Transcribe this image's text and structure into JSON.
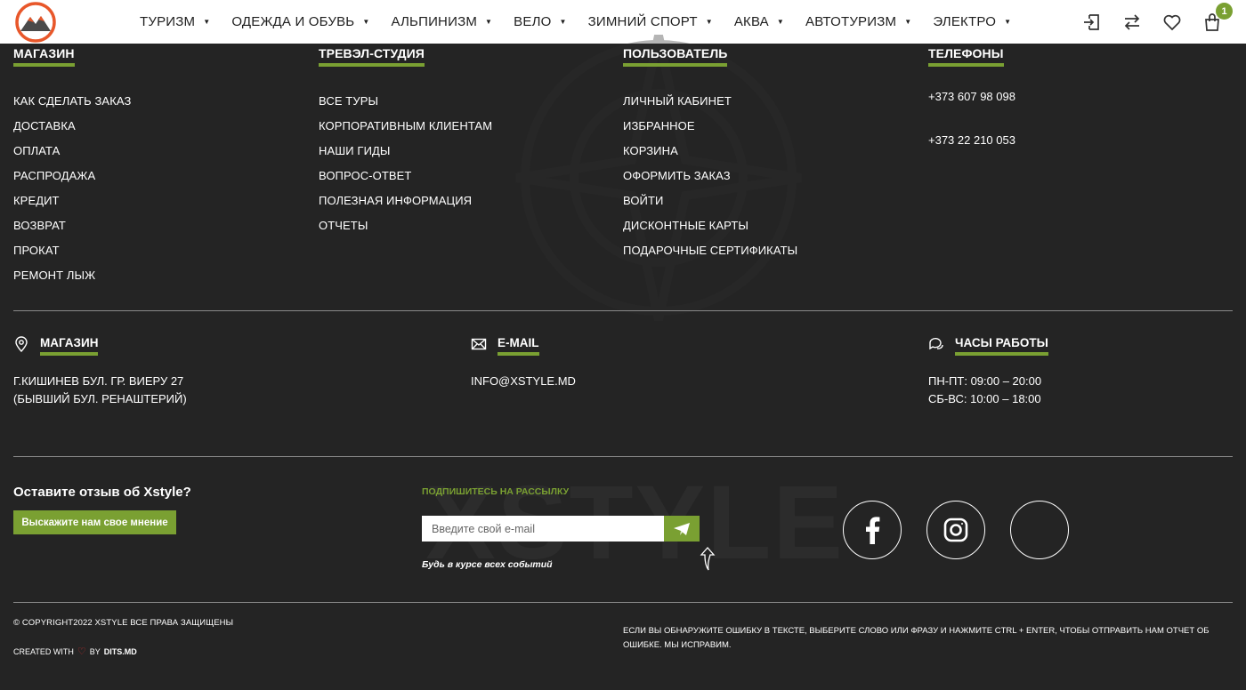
{
  "header": {
    "nav": [
      {
        "label": "ТУРИЗМ"
      },
      {
        "label": "ОДЕЖДА И ОБУВЬ"
      },
      {
        "label": "АЛЬПИНИЗМ"
      },
      {
        "label": "ВЕЛО"
      },
      {
        "label": "ЗИМНИЙ СПОРТ"
      },
      {
        "label": "АКВА"
      },
      {
        "label": "АВТОТУРИЗМ"
      },
      {
        "label": "ЭЛЕКТРО"
      }
    ],
    "cart_count": "1",
    "icons": [
      "login-icon",
      "compare-icon",
      "wishlist-icon",
      "cart-icon"
    ]
  },
  "columns": {
    "shop": {
      "title": "МАГАЗИН",
      "links": [
        "КАК СДЕЛАТЬ ЗАКАЗ",
        "ДОСТАВКА",
        "ОПЛАТА",
        "РАСПРОДАЖА",
        "КРЕДИТ",
        "ВОЗВРАТ",
        "ПРОКАТ",
        "РЕМОНТ ЛЫЖ"
      ]
    },
    "travel": {
      "title": "ТРЕВЭЛ-СТУДИЯ",
      "links": [
        "ВСЕ ТУРЫ",
        "КОРПОРАТИВНЫМ КЛИЕНТАМ",
        "НАШИ ГИДЫ",
        "ВОПРОС-ОТВЕТ",
        "ПОЛЕЗНАЯ ИНФОРМАЦИЯ",
        "ОТЧЕТЫ"
      ]
    },
    "user": {
      "title": "ПОЛЬЗОВАТЕЛЬ",
      "links": [
        "ЛИЧНЫЙ КАБИНЕТ",
        "ИЗБРАННОЕ",
        "КОРЗИНА",
        "ОФОРМИТЬ ЗАКАЗ",
        "ВОЙТИ",
        "ДИСКОНТНЫЕ КАРТЫ",
        "ПОДАРОЧНЫЕ СЕРТИФИКАТЫ"
      ]
    },
    "phones": {
      "title": "ТЕЛЕФОНЫ",
      "items": [
        "+373 607 98 098",
        "+373 22 210 053"
      ]
    }
  },
  "info": {
    "store": {
      "title": "МАГАЗИН",
      "line1": "Г.КИШИНЕВ БУЛ. ГР. ВИЕРУ 27",
      "line2": "(БЫВШИЙ БУЛ. РЕНАШТЕРИЙ)",
      "icon": "location-pin-icon"
    },
    "email": {
      "title": "E-MAIL",
      "value": "INFO@XSTYLE.MD",
      "icon": "envelope-icon"
    },
    "hours": {
      "title": "ЧАСЫ РАБОТЫ",
      "line1": "ПН-ПТ: 09:00 – 20:00",
      "line2": "СБ-ВС: 10:00 – 18:00",
      "icon": "chat-bubbles-icon"
    }
  },
  "review": {
    "title": "Оставите отзыв об Xstyle?",
    "button": "Выскажите нам свое мнение"
  },
  "subscribe": {
    "label": "ПОДПИШИТЕСЬ НА РАССЫЛКУ",
    "placeholder": "Введите свой e-mail",
    "note": "Будь в курсе всех событий"
  },
  "watermark": "XSTYLE",
  "social": [
    "facebook-icon",
    "instagram-icon",
    "empty-social-icon"
  ],
  "footer": {
    "copyright": "© COPYRIGHT2022 XSTYLE ВСЕ ПРАВА ЗАЩИЩЕНЫ",
    "created_with": "CREATED WITH",
    "by": "BY",
    "dits": "DITS.MD",
    "notice": "ЕСЛИ ВЫ ОБНАРУЖИТЕ ОШИБКУ В ТЕКСТЕ, ВЫБЕРИТЕ СЛОВО ИЛИ ФРАЗУ И НАЖМИТЕ CTRL + ENTER, ЧТОБЫ ОТПРАВИТЬ НАМ ОТЧЕТ ОБ ОШИБКЕ. МЫ ИСПРАВИМ."
  },
  "colors": {
    "accent": "#7aa032",
    "background": "#242424",
    "header": "#ffffff",
    "logo_orange": "#e8572a"
  }
}
